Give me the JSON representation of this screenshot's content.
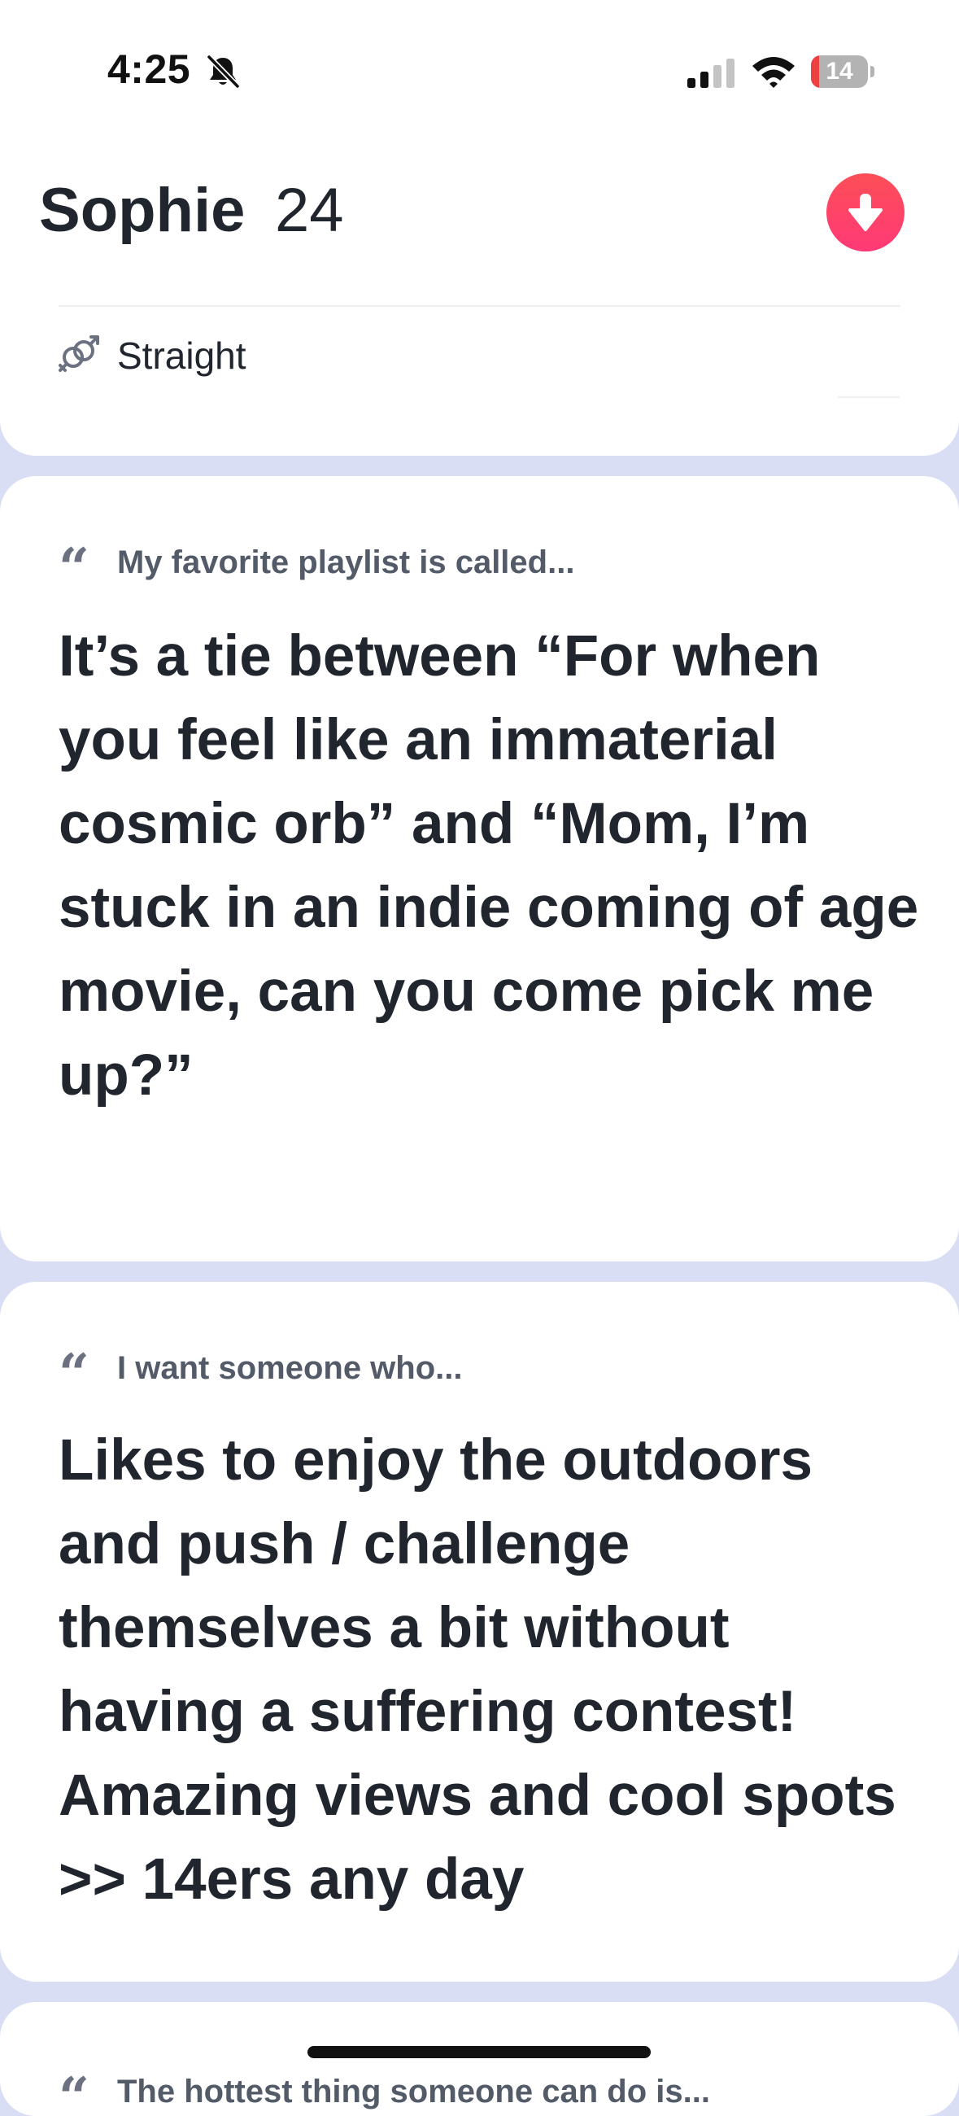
{
  "status_bar": {
    "time": "4:25",
    "bell_icon": "bell-slash-icon",
    "signal_icon": "cellular-signal-icon",
    "wifi_icon": "wifi-icon",
    "battery_percent": "14",
    "battery_level": 0.14,
    "battery_low_color": "#ec4141"
  },
  "profile": {
    "name": "Sophie",
    "age": "24",
    "collapse_icon": "arrow-down-icon",
    "accent_color": "#fd4e57",
    "orientation_icon": "orientation-icon",
    "orientation": "Straight"
  },
  "prompts": [
    {
      "icon": "quote-icon",
      "question": "My favorite playlist is called...",
      "answer": "It’s a tie between “For when you feel like an immaterial cosmic orb” and “Mom, I’m stuck in an indie coming of age movie, can you come pick me up?”"
    },
    {
      "icon": "quote-icon",
      "question": "I want someone who...",
      "answer": "Likes to enjoy the outdoors and push / challenge themselves a bit without having a suffering contest! Amazing views and cool spots >> 14ers any day"
    },
    {
      "icon": "quote-icon",
      "question": "The hottest thing someone can do is..."
    }
  ],
  "quote_glyph": "“"
}
